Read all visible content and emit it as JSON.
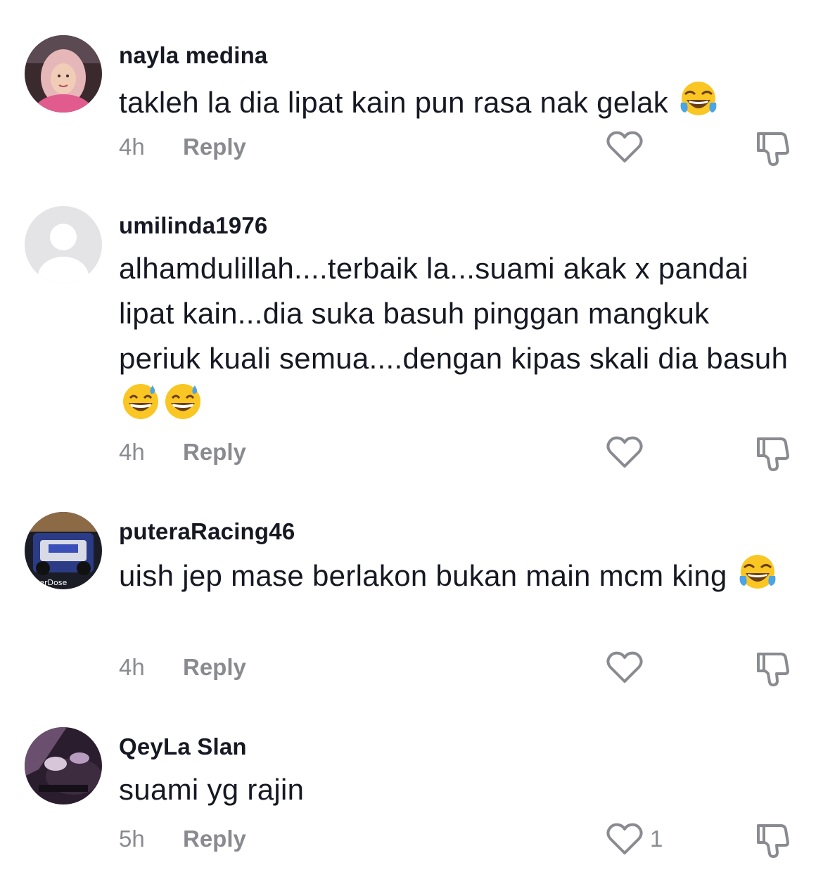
{
  "comments": [
    {
      "username": "nayla medina",
      "text": "takleh la dia lipat kain pun rasa nak gelak",
      "emojis": [
        "face-with-tears-of-joy"
      ],
      "time": "4h",
      "reply_label": "Reply",
      "like_count": ""
    },
    {
      "username": "umilinda1976",
      "text": "alhamdulillah....terbaik la...suami akak x pandai lipat kain...dia suka basuh pinggan mangkuk periuk kuali semua....dengan kipas skali dia basuh",
      "emojis": [
        "grinning-face-with-sweat",
        "grinning-face-with-sweat"
      ],
      "time": "4h",
      "reply_label": "Reply",
      "like_count": ""
    },
    {
      "username": "puteraRacing46",
      "text": "uish jep mase berlakon bukan main mcm king",
      "emojis": [
        "face-with-tears-of-joy"
      ],
      "time": "4h",
      "reply_label": "Reply",
      "like_count": ""
    },
    {
      "username": "QeyLa Slan",
      "text": "suami yg rajin",
      "emojis": [],
      "time": "5h",
      "reply_label": "Reply",
      "like_count": "1"
    }
  ],
  "colors": {
    "text_primary": "#161823",
    "text_secondary": "#8a8b91",
    "icon_outline": "#8a8b91",
    "background": "#ffffff"
  },
  "icons": {
    "like": "heart-outline-icon",
    "dislike": "thumbs-down-outline-icon"
  }
}
